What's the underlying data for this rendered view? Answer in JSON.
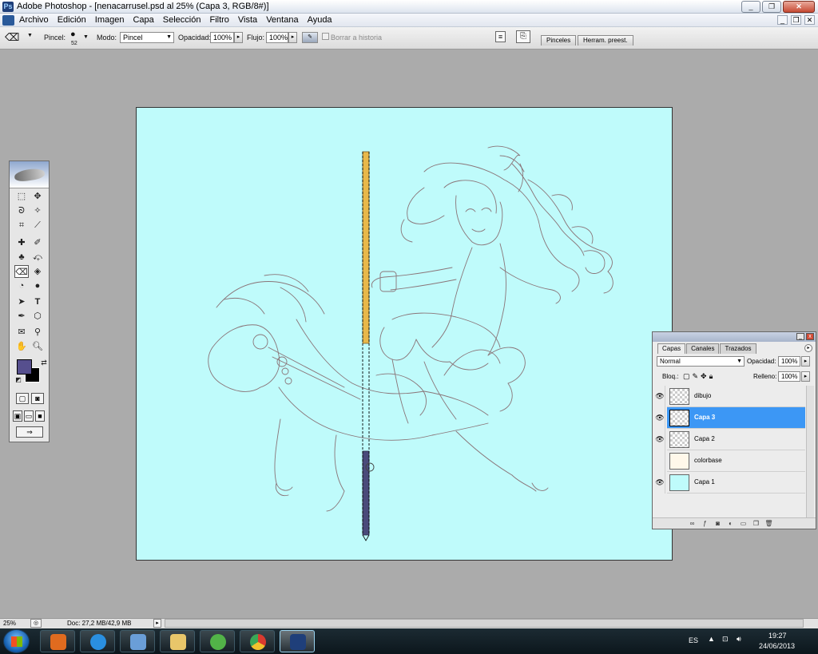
{
  "window": {
    "title": "Adobe Photoshop - [nenacarrusel.psd al 25% (Capa 3, RGB/8#)]",
    "app_icon": "photoshop-icon"
  },
  "menu": {
    "items": [
      "Archivo",
      "Edición",
      "Imagen",
      "Capa",
      "Selección",
      "Filtro",
      "Vista",
      "Ventana",
      "Ayuda"
    ]
  },
  "options": {
    "brush_label": "Pincel:",
    "brush_size": "52",
    "mode_label": "Modo:",
    "mode_value": "Pincel",
    "opacity_label": "Opacidad:",
    "opacity_value": "100%",
    "flow_label": "Flujo:",
    "flow_value": "100%",
    "erase_history_label": "Borrar a historia",
    "tab_brushes": "Pinceles",
    "tab_presets": "Herram. preest."
  },
  "toolbox": {
    "foreground_color": "#564f8e",
    "background_color": "#000000"
  },
  "layers_panel": {
    "tabs": [
      "Capas",
      "Canales",
      "Trazados"
    ],
    "blend_mode": "Normal",
    "opacity_label": "Opacidad:",
    "opacity_value": "100%",
    "lock_label": "Bloq.:",
    "fill_label": "Relleno:",
    "fill_value": "100%",
    "layers": [
      {
        "name": "dibujo",
        "visible": true,
        "selected": false
      },
      {
        "name": "Capa 3",
        "visible": true,
        "selected": true
      },
      {
        "name": "Capa 2",
        "visible": true,
        "selected": false
      },
      {
        "name": "colorbase",
        "visible": false,
        "selected": false
      },
      {
        "name": "Capa 1",
        "visible": true,
        "selected": false
      }
    ]
  },
  "status": {
    "zoom": "25%",
    "doc": "Doc: 27,2 MB/42,9 MB"
  },
  "taskbar": {
    "language": "ES",
    "time": "19:27",
    "date": "24/06/2013"
  },
  "colors": {
    "canvas": "#bffbfb",
    "sketch_line": "#8a7478",
    "pole_top": "#e8b84a",
    "pole_bottom": "#4a4a7a",
    "selection": "#3c97f5"
  }
}
